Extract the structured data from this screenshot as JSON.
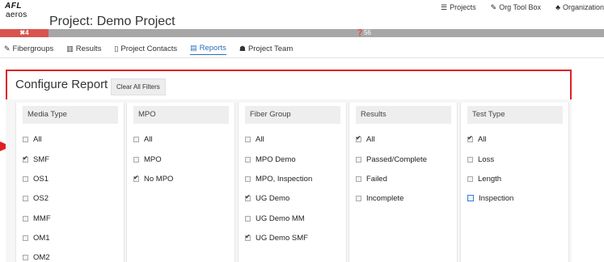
{
  "header": {
    "logo_brand": "AFL",
    "logo_product": "aeros",
    "project_title": "Project: Demo Project",
    "top_links": [
      {
        "label": "Projects",
        "icon": "list-icon"
      },
      {
        "label": "Org Tool Box",
        "icon": "wrench-icon"
      },
      {
        "label": "Organization",
        "icon": "sitemap-icon"
      }
    ]
  },
  "notifications": {
    "alert_count": "✖4",
    "info_count": "❓56"
  },
  "tabs": [
    {
      "label": "Fibergroups",
      "icon": "wrench-icon"
    },
    {
      "label": "Results",
      "icon": "bar-chart-icon"
    },
    {
      "label": "Project Contacts",
      "icon": "address-book-icon"
    },
    {
      "label": "Reports",
      "icon": "report-icon",
      "active": true
    },
    {
      "label": "Project Team",
      "icon": "team-icon"
    }
  ],
  "report": {
    "title": "Configure Report",
    "clear_filters": "Clear All Filters",
    "columns": [
      {
        "header": "Media Type",
        "options": [
          {
            "label": "All",
            "checked": false
          },
          {
            "label": "SMF",
            "checked": true
          },
          {
            "label": "OS1",
            "checked": false
          },
          {
            "label": "OS2",
            "checked": false
          },
          {
            "label": "MMF",
            "checked": false
          },
          {
            "label": "OM1",
            "checked": false
          },
          {
            "label": "OM2",
            "checked": false
          }
        ]
      },
      {
        "header": "MPO",
        "options": [
          {
            "label": "All",
            "checked": false
          },
          {
            "label": "MPO",
            "checked": false
          },
          {
            "label": "No MPO",
            "checked": true
          }
        ]
      },
      {
        "header": "Fiber Group",
        "options": [
          {
            "label": "All",
            "checked": false
          },
          {
            "label": "MPO Demo",
            "checked": false
          },
          {
            "label": "MPO, Inspection",
            "checked": false
          },
          {
            "label": "UG Demo",
            "checked": true
          },
          {
            "label": "UG Demo MM",
            "checked": false
          },
          {
            "label": "UG Demo SMF",
            "checked": true
          }
        ]
      },
      {
        "header": "Results",
        "options": [
          {
            "label": "All",
            "checked": true
          },
          {
            "label": "Passed/Complete",
            "checked": false
          },
          {
            "label": "Failed",
            "checked": false
          },
          {
            "label": "Incomplete",
            "checked": false
          }
        ]
      },
      {
        "header": "Test Type",
        "options": [
          {
            "label": "All",
            "checked": true
          },
          {
            "label": "Loss",
            "checked": false
          },
          {
            "label": "Length",
            "checked": false
          },
          {
            "label": "Inspection",
            "checked": false,
            "focused": true
          }
        ]
      }
    ]
  },
  "colors": {
    "highlight_frame": "#e02020",
    "arrow": "#e02020",
    "active_tab": "#2a6ebb",
    "alert": "#d9534f",
    "notify_bar": "#a7a7a7"
  }
}
